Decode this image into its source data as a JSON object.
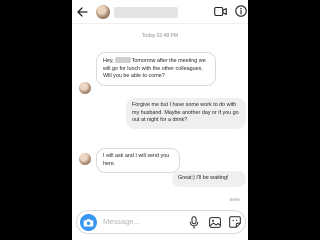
{
  "header": {
    "back_icon": "arrow-left-icon",
    "video_icon": "video-camera-icon",
    "info_icon": "info-icon"
  },
  "timestamp": "Today 02:48 PM",
  "messages": [
    {
      "sender": "them",
      "pre": "Hey,",
      "post": "Tomorrow after the meeting we will go for lunch with the other colleagues. Will you be able to come?"
    },
    {
      "sender": "me",
      "text": "Forgive me but I have some work to do with my husband. Maybe another day or if you go out at night for a drink?"
    },
    {
      "sender": "them",
      "text": "I will ask and I will send you here."
    },
    {
      "sender": "me",
      "text": "Great:) I'll be waiting!"
    }
  ],
  "seen_label": "Seen",
  "composer": {
    "placeholder": "Message...",
    "camera_icon": "camera-icon",
    "mic_icon": "microphone-icon",
    "gallery_icon": "gallery-icon",
    "sticker_icon": "sticker-icon"
  },
  "colors": {
    "accent": "#3797f0",
    "incoming_bubble": "#ffffff",
    "outgoing_bubble": "#efefef",
    "muted_text": "#8e8e8e"
  }
}
